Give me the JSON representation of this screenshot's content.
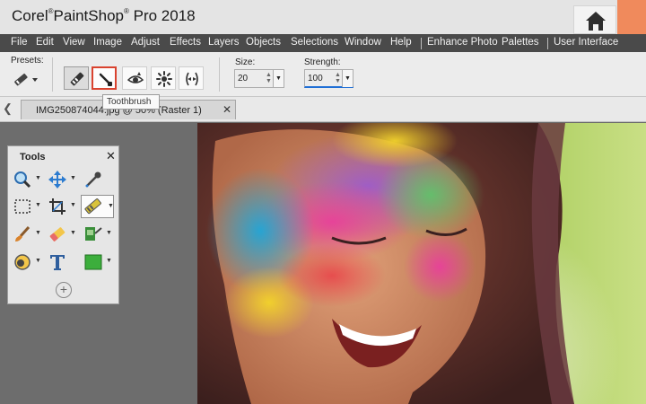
{
  "window": {
    "title_brand": "Corel",
    "title_mark": "®",
    "title_product": "PaintShop",
    "title_version": "Pro 2018",
    "home_icon": "home-icon"
  },
  "menu": {
    "items": [
      "File",
      "Edit",
      "View",
      "Image",
      "Adjust",
      "Effects",
      "Layers",
      "Objects",
      "Selections",
      "Window",
      "Help",
      "Enhance Photo",
      "Palettes",
      "User Interface"
    ]
  },
  "tool_options": {
    "presets_label": "Presets:",
    "size_label": "Size:",
    "size_value": "20",
    "strength_label": "Strength:",
    "strength_value": "100",
    "buttons": [
      "blemish-remover-icon",
      "toothbrush-icon",
      "eye-drop-icon",
      "red-eye-icon",
      "thinify-icon"
    ],
    "tooltip": "Toothbrush"
  },
  "tabs": {
    "document_tab": "IMG250874044.jpg @ 50% (Raster 1)",
    "close_glyph": "✕",
    "scroll_glyph": "❮"
  },
  "tools_palette": {
    "title": "Tools",
    "close_glyph": "✕",
    "add_glyph": "+",
    "tools": [
      "zoom-icon",
      "move-icon",
      "dropper-icon",
      "selection-icon",
      "crop-icon",
      "makeover-icon",
      "paint-brush-icon",
      "eraser-icon",
      "picture-tube-icon",
      "fill-icon",
      "text-icon",
      "rectangle-shape-icon"
    ]
  },
  "colors": {
    "menu_bg": "#4a4a4a",
    "accent_orange": "#f08a5c",
    "highlight_red": "#d9432f",
    "strength_underline": "#1f6fd6"
  }
}
